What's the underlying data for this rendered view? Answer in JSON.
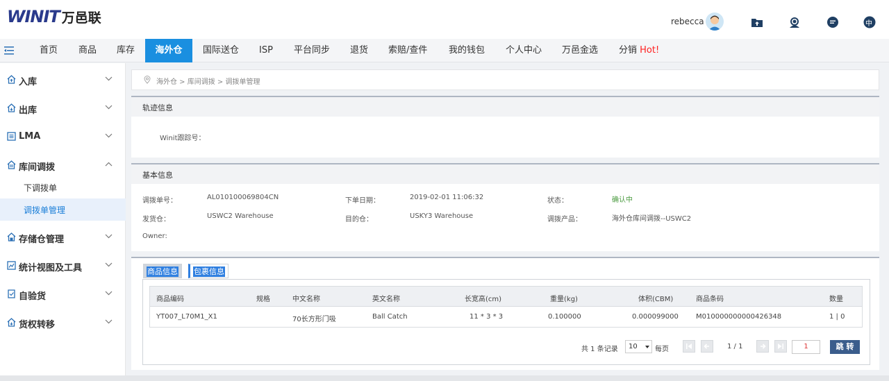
{
  "header": {
    "logo_mark": "WINIT",
    "logo_cn": "万邑联",
    "username": "rebecca",
    "icons": [
      "upload-folder-icon",
      "support-agent-icon",
      "chat-icon",
      "language-icon"
    ],
    "lang_label": "中"
  },
  "nav": {
    "items": [
      {
        "label": "首页"
      },
      {
        "label": "商品"
      },
      {
        "label": "库存"
      },
      {
        "label": "海外仓",
        "active": true
      },
      {
        "label": "国际送仓"
      },
      {
        "label": "ISP"
      },
      {
        "label": "平台同步"
      },
      {
        "label": "退货"
      },
      {
        "label": "索赔/查件"
      },
      {
        "label": "我的钱包"
      },
      {
        "label": "个人中心"
      },
      {
        "label": "万邑金选"
      },
      {
        "label": "分销",
        "badge": "Hot!"
      }
    ]
  },
  "sidebar": {
    "items": [
      {
        "label": "入库"
      },
      {
        "label": "出库"
      },
      {
        "label": "LMA"
      },
      {
        "label": "库间调拨",
        "expanded": true,
        "children": [
          {
            "label": "下调拨单"
          },
          {
            "label": "调拨单管理",
            "active": true
          }
        ]
      },
      {
        "label": "存储仓管理"
      },
      {
        "label": "统计视图及工具"
      },
      {
        "label": "自验货"
      },
      {
        "label": "货权转移"
      }
    ]
  },
  "breadcrumb": {
    "text": "海外仓 > 库间调拨 > 调拨单管理"
  },
  "track": {
    "title": "轨迹信息",
    "tracking_label": "Winit跟踪号："
  },
  "basic": {
    "title": "基本信息",
    "order_no_label": "调拨单号：",
    "order_no": "AL010100069804CN",
    "order_date_label": "下单日期：",
    "order_date": "2019-02-01 11:06:32",
    "status_label": "状态：",
    "status": "确认中",
    "ship_from_label": "发货仓：",
    "ship_from": "USWC2 Warehouse",
    "dest_label": "目的仓：",
    "dest": "USKY3 Warehouse",
    "product_label": "调拨产品：",
    "product": "海外仓库间调拨--USWC2",
    "owner_label": "Owner:"
  },
  "tabs": [
    {
      "label": "商品信息",
      "active": true
    },
    {
      "label": "包裹信息",
      "active": false
    }
  ],
  "table": {
    "headers": [
      "商品编码",
      "规格",
      "中文名称",
      "英文名称",
      "长宽高(cm)",
      "重量(kg)",
      "体积(CBM)",
      "商品条码",
      "数量"
    ],
    "rows": [
      [
        "YT007_L70M1_X1",
        "",
        "70长方形门吸",
        "Ball Catch",
        "11 * 3 * 3",
        "0.100000",
        "0.000099000",
        "M010000000000426348",
        "1 | 0"
      ]
    ]
  },
  "pagination": {
    "total_text": "共 1 条记录",
    "page_size": "10",
    "per_page_label": "每页",
    "page_info": "1 / 1",
    "page_input": "1",
    "jump_label": "跳 转"
  }
}
